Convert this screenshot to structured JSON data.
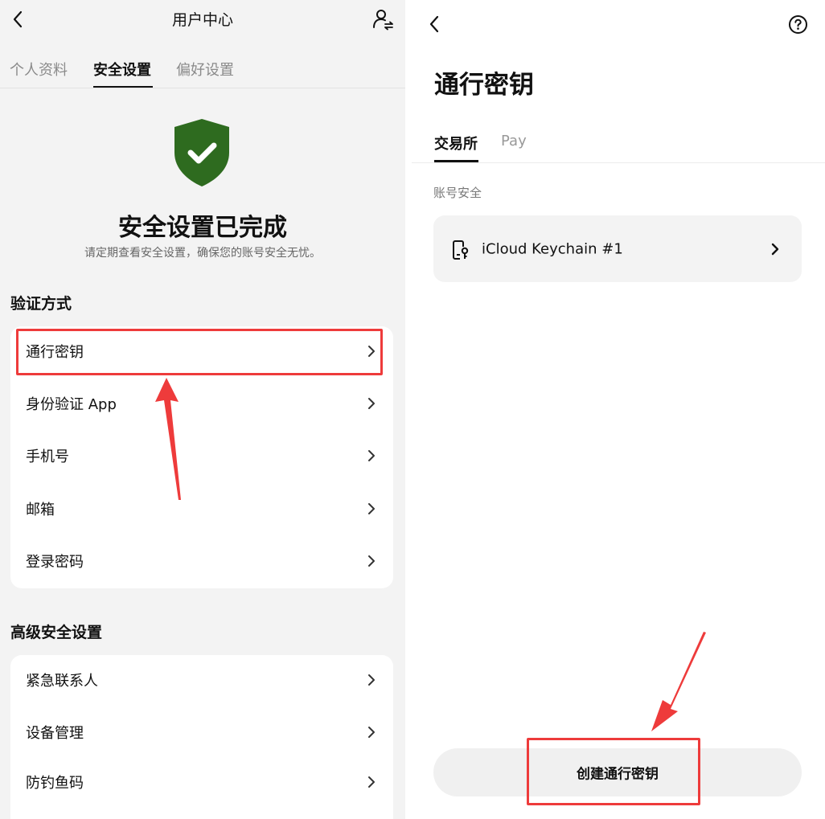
{
  "left": {
    "header": {
      "title": "用户中心",
      "back_icon": "back-arrow-icon",
      "user_switch_icon": "user-switch-icon"
    },
    "tabs": [
      {
        "label": "个人资料",
        "active": false
      },
      {
        "label": "安全设置",
        "active": true
      },
      {
        "label": "偏好设置",
        "active": false
      }
    ],
    "status": {
      "shield_icon": "shield-check-icon",
      "shield_color": "#2e6b1f",
      "title": "安全设置已完成",
      "subtitle": "请定期查看安全设置，确保您的账号安全无忧。"
    },
    "verification": {
      "heading": "验证方式",
      "items": [
        {
          "label": "通行密钥",
          "highlighted": true
        },
        {
          "label": "身份验证 App"
        },
        {
          "label": "手机号"
        },
        {
          "label": "邮箱"
        },
        {
          "label": "登录密码"
        }
      ]
    },
    "advanced": {
      "heading": "高级安全设置",
      "items": [
        {
          "label": "紧急联系人"
        },
        {
          "label": "设备管理"
        },
        {
          "label": "防钓鱼码"
        }
      ]
    }
  },
  "right": {
    "header": {
      "back_icon": "back-arrow-icon",
      "help_icon": "help-circle-icon"
    },
    "title": "通行密钥",
    "tabs": [
      {
        "label": "交易所",
        "active": true
      },
      {
        "label": "Pay",
        "active": false
      }
    ],
    "section_label": "账号安全",
    "passkey_item": {
      "label": "iCloud Keychain #1",
      "icon": "device-key-icon"
    },
    "create_button": {
      "label": "创建通行密钥",
      "highlighted": true
    }
  },
  "annotation_color": "#ee3b3b"
}
